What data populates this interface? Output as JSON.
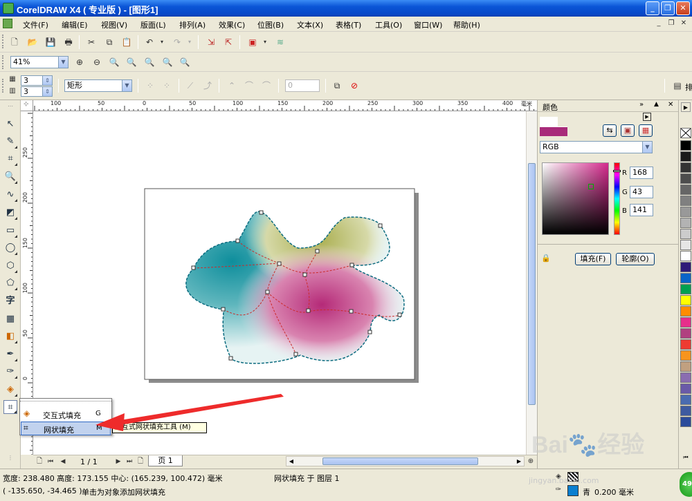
{
  "window": {
    "title": "CorelDRAW X4 ( 专业版 ) - [图形1]"
  },
  "menu": [
    "文件(F)",
    "编辑(E)",
    "视图(V)",
    "版面(L)",
    "排列(A)",
    "效果(C)",
    "位图(B)",
    "文本(X)",
    "表格(T)",
    "工具(O)",
    "窗口(W)",
    "帮助(H)"
  ],
  "zoom": {
    "value": "41%"
  },
  "propbar": {
    "rows": "3",
    "cols": "3",
    "shape_mode": "矩形",
    "smoothness": "0",
    "right_label": "排"
  },
  "rulers": {
    "top_labels": [
      "100",
      "50",
      "0",
      "50",
      "100",
      "150",
      "200",
      "250",
      "300",
      "350",
      "400"
    ],
    "unit": "毫米",
    "left_labels": [
      "250",
      "200",
      "150",
      "100",
      "50",
      "0"
    ]
  },
  "docker": {
    "title": "颜色",
    "color_model": "RGB",
    "r_label": "R",
    "r_value": "168",
    "g_label": "G",
    "g_value": "43",
    "b_label": "B",
    "b_value": "141",
    "fill_button": "填充(F)",
    "outline_button": "轮廓(O)",
    "current_color": "#a82b8d"
  },
  "palette": [
    "#ffffff",
    "#000000",
    "#1a1a1a",
    "#333333",
    "#4d4d4d",
    "#666666",
    "#808080",
    "#999999",
    "#b3b3b3",
    "#cccccc",
    "#e6e6e6",
    "#ffffff",
    "#2e1a78",
    "#0a64c8",
    "#00a050",
    "#ffff00",
    "#ff8c00",
    "#e62e8b",
    "#b04080",
    "#ee3b32",
    "#f7941d",
    "#c0a080",
    "#8a6db0",
    "#6a5aa8",
    "#4a6bb0",
    "#3e5aa0",
    "#2b4b9b"
  ],
  "pages": {
    "counter": "1 / 1",
    "tab": "页 1"
  },
  "flyout": {
    "items": [
      {
        "label": "交互式填充",
        "key": "G"
      },
      {
        "label": "网状填充",
        "key": "M"
      }
    ],
    "tooltip": "交互式网状填充工具 (M)"
  },
  "status": {
    "dimensions": "宽度: 238.480  高度: 173.155  中心: (165.239, 100.472)  毫米",
    "layer": "网状填充 于 图层 1",
    "cursor": "( -135.650, -34.465 )",
    "hint": "单击为对象添加网状填充",
    "fill_name": "青",
    "outline_width": "0.200 毫米",
    "fill_color": "#0a7fd0",
    "watermark_site": "jingyan.baidu.com"
  }
}
